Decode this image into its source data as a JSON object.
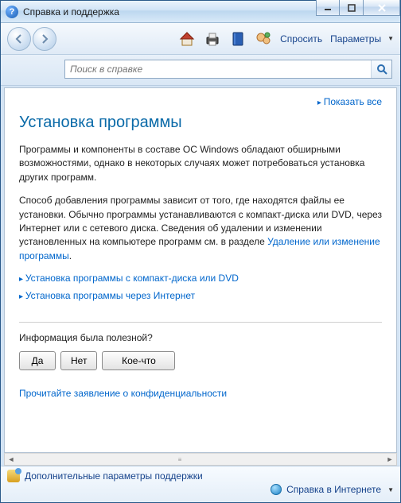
{
  "window": {
    "title": "Справка и поддержка"
  },
  "toolbar": {
    "ask": "Спросить",
    "options": "Параметры"
  },
  "search": {
    "placeholder": "Поиск в справке"
  },
  "content": {
    "show_all": "Показать все",
    "title": "Установка программы",
    "para1": "Программы и компоненты в составе ОС Windows обладают обширными возможностями, однако в некоторых случаях может потребоваться установка других программ.",
    "para2_a": "Способ добавления программы зависит от того, где находятся файлы ее установки. Обычно программы устанавливаются с компакт-диска или DVD, через Интернет или с сетевого диска. Сведения об удалении и изменении установленных на компьютере программ см. в разделе ",
    "para2_link": "Удаление или изменение программы",
    "para2_b": ".",
    "expand1": "Установка программы с компакт-диска или DVD",
    "expand2": "Установка программы через Интернет",
    "feedback_q": "Информация была полезной?",
    "btn_yes": "Да",
    "btn_no": "Нет",
    "btn_some": "Кое-что",
    "privacy": "Прочитайте заявление о конфиденциальности"
  },
  "statusbar": {
    "more_options": "Дополнительные параметры поддержки",
    "online_help": "Справка в Интернете"
  }
}
